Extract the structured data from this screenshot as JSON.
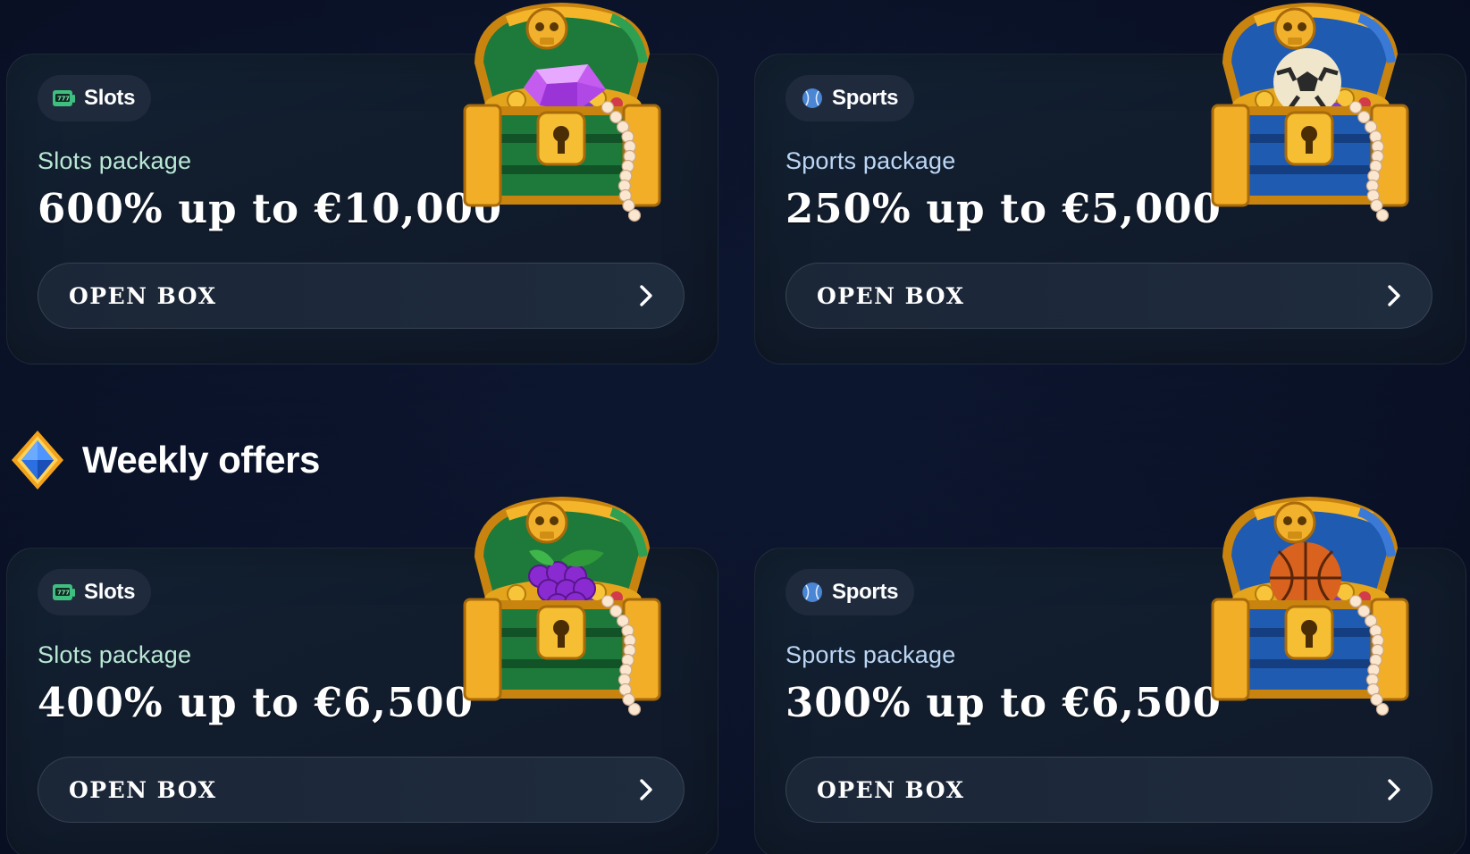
{
  "top_offers": [
    {
      "category": "Slots",
      "category_icon": "slot-machine-icon",
      "package": "Slots package",
      "headline": "600% up to €10,000",
      "button": "OPEN BOX",
      "chest_color": "#1e7a3a",
      "chest_prize": "gem"
    },
    {
      "category": "Sports",
      "category_icon": "baseball-icon",
      "package": "Sports package",
      "headline": "250% up to €5,000",
      "button": "OPEN BOX",
      "chest_color": "#1f5bb0",
      "chest_prize": "soccer-ball"
    }
  ],
  "weekly": {
    "title": "Weekly offers",
    "icon": "diamond-badge-icon",
    "offers": [
      {
        "category": "Slots",
        "category_icon": "slot-machine-icon",
        "package": "Slots package",
        "headline": "400% up to €6,500",
        "button": "OPEN BOX",
        "chest_color": "#1e7a3a",
        "chest_prize": "grapes"
      },
      {
        "category": "Sports",
        "category_icon": "baseball-icon",
        "package": "Sports package",
        "headline": "300% up to €6,500",
        "button": "OPEN BOX",
        "chest_color": "#1f5bb0",
        "chest_prize": "basketball"
      }
    ]
  },
  "colors": {
    "background": "#070b1c",
    "card": "#121e2e",
    "chip": "#1f2b3d",
    "slots_accent": "#b9e8d4",
    "sports_accent": "#bcd6f5"
  }
}
